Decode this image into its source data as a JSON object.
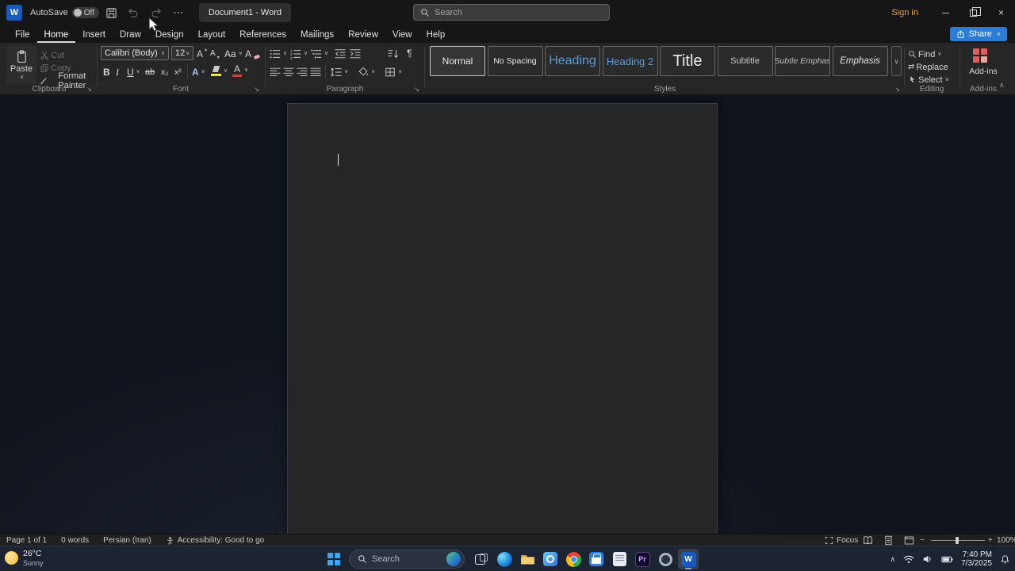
{
  "titlebar": {
    "autosave_label": "AutoSave",
    "autosave_state": "Off",
    "doc_tab": "Document1 - Word",
    "search_placeholder": "Search",
    "sign_in_label": "Sign in"
  },
  "ribbon_tabs": {
    "items": [
      "File",
      "Home",
      "Insert",
      "Draw",
      "Design",
      "Layout",
      "References",
      "Mailings",
      "Review",
      "View",
      "Help"
    ],
    "share_label": "Share"
  },
  "ribbon": {
    "clipboard": {
      "group_label": "Clipboard",
      "paste_label": "Paste",
      "cut_label": "Cut",
      "copy_label": "Copy",
      "format_painter_label": "Format Painter"
    },
    "font": {
      "group_label": "Font",
      "font_name": "Calibri (Body)",
      "font_size": "12"
    },
    "paragraph": {
      "group_label": "Paragraph"
    },
    "styles": {
      "group_label": "Styles",
      "items": [
        "Normal",
        "No Spacing",
        "Heading",
        "Heading 2",
        "Title",
        "Subtitle",
        "Subtle Emphas",
        "Emphasis"
      ]
    },
    "editing": {
      "group_label": "Editing",
      "find_label": "Find",
      "replace_label": "Replace",
      "select_label": "Select"
    },
    "addins": {
      "group_label": "Add-ins",
      "button_label": "Add-ins"
    }
  },
  "statusbar": {
    "page_info": "Page 1 of 1",
    "word_count": "0 words",
    "language": "Persian (Iran)",
    "accessibility": "Accessibility: Good to go",
    "focus_label": "Focus",
    "zoom_level": "100%"
  },
  "taskbar": {
    "weather_temp": "26°C",
    "weather_desc": "Sunny",
    "search_placeholder": "Search",
    "clock_time": "7:40 PM",
    "clock_date": "7/3/2025"
  },
  "glyphs": {
    "caret": "∨",
    "more": "⋯",
    "bold": "B",
    "italic": "I",
    "underline": "U",
    "strikethrough": "ab",
    "subscript": "x₂",
    "superscript": "x²",
    "grow_font": "A",
    "shrink_font": "A",
    "arrow_up_small": "▴",
    "arrow_down_small": "▾",
    "change_case": "Aa",
    "clear_format": "A",
    "text_effects": "A",
    "font_color": "A",
    "paragraph_mark": "¶",
    "replace_icon": "⇄",
    "collapse_ribbon": "∧",
    "tray_chevron": "∧",
    "zoom_out": "−",
    "zoom_in": "+",
    "close": "×",
    "minimize": "─",
    "launcher": "↘",
    "word_logo": "W",
    "premiere_label": "Pr"
  }
}
